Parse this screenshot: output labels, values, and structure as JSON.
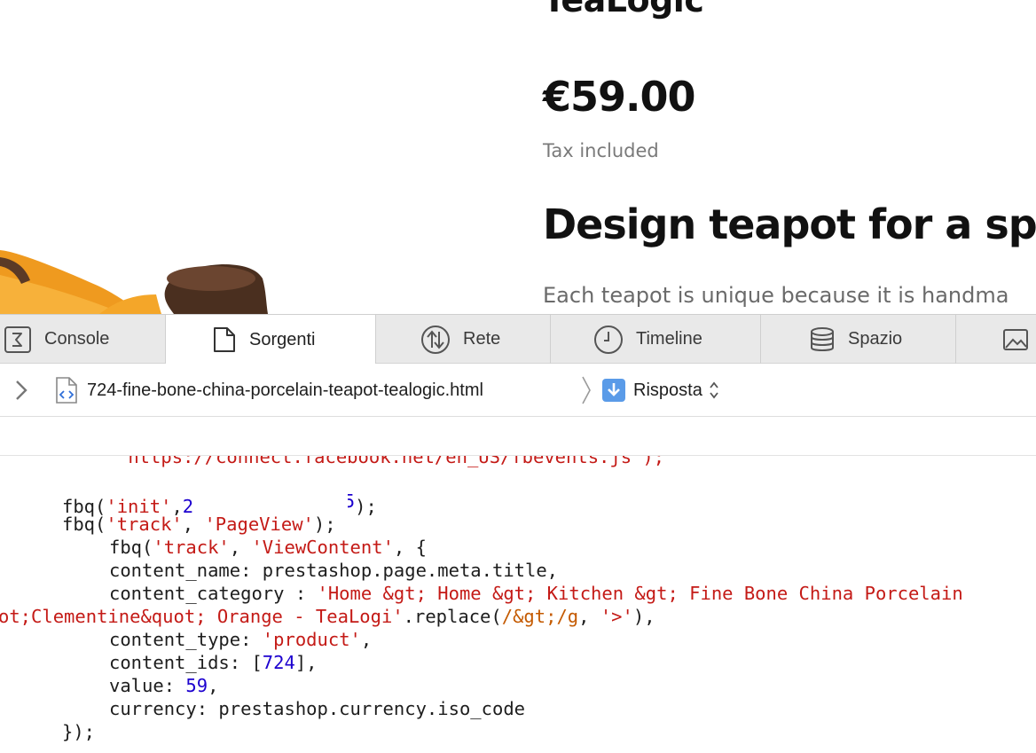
{
  "page": {
    "brand": "TeaLogic",
    "price": "€59.00",
    "tax_note": "Tax included",
    "headline": "Design teapot for a sp",
    "description": "Each teapot is unique because it is handma"
  },
  "devtools": {
    "tabs": [
      {
        "label": "Console",
        "icon": "console-icon"
      },
      {
        "label": "Sorgenti",
        "icon": "document-icon"
      },
      {
        "label": "Rete",
        "icon": "network-icon"
      },
      {
        "label": "Timeline",
        "icon": "clock-icon"
      },
      {
        "label": "Spazio",
        "icon": "storage-icon"
      },
      {
        "label": "",
        "icon": "image-icon"
      }
    ],
    "active_tab": "Sorgenti",
    "path": {
      "file": "724-fine-bone-china-porcelain-teapot-tealogic.html",
      "mode": "Risposta"
    }
  },
  "code": {
    "line_top_cut": "\"https://connect.facebook.net/en_US/fbevents.js\");",
    "l1_pre": "fbq(",
    "l1_s": "'init'",
    "l1_c": ",",
    "l1_n1": "2",
    "l1_n2": "5",
    "l1_end": ");",
    "l2_pre": "fbq(",
    "l2_s1": "'track'",
    "l2_c": ", ",
    "l2_s2": "'PageView'",
    "l2_end": ");",
    "l3_pre": "fbq(",
    "l3_s1": "'track'",
    "l3_c": ", ",
    "l3_s2": "'ViewContent'",
    "l3_end": ", {",
    "l4": "content_name: prestashop.page.meta.title,",
    "l5_pre": "content_category : ",
    "l5_s": "'Home &gt; Home &gt; Kitchen &gt; Fine Bone China Porcelain",
    "l6_s": "ot;Clementine&quot; Orange - TeaLogi'",
    "l6_m": ".replace(",
    "l6_rx": "/&gt;/g",
    "l6_c": ", ",
    "l6_s2": "'>'",
    "l6_end": "),",
    "l7_pre": "content_type: ",
    "l7_s": "'product'",
    "l7_end": ",",
    "l8_pre": "content_ids: [",
    "l8_n": "724",
    "l8_end": "],",
    "l9_pre": "value: ",
    "l9_n": "59",
    "l9_end": ",",
    "l10": "currency: prestashop.currency.iso_code",
    "l11": "});"
  },
  "colors": {
    "string": "#c41a16",
    "number": "#1c00cf",
    "regex": "#c45a00",
    "tab_bar": "#e9e9e9"
  }
}
